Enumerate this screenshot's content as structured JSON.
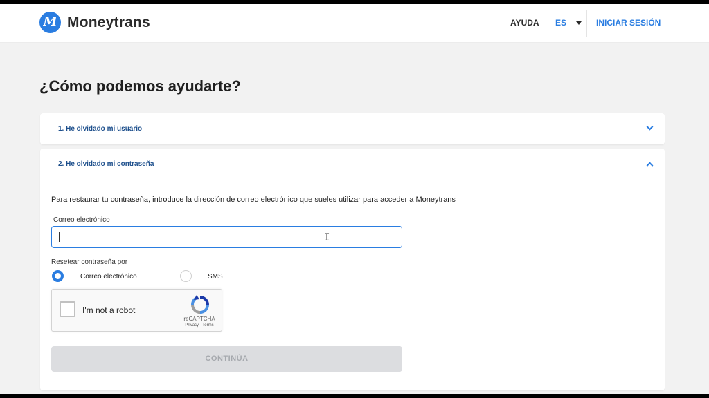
{
  "header": {
    "brand": "Moneytrans",
    "nav_help": "AYUDA",
    "language": "ES",
    "login": "INICIAR SESIÓN"
  },
  "page": {
    "title": "¿Cómo podemos ayudarte?"
  },
  "accordion": [
    {
      "title": "1. He olvidado mi usuario",
      "expanded": false
    },
    {
      "title": "2. He olvidado mi contraseña",
      "expanded": true
    }
  ],
  "form": {
    "instructions": "Para restaurar tu contraseña, introduce la dirección de correo electrónico que sueles utilizar para acceder a Moneytrans",
    "email_label": "Correo electrónico",
    "email_value": "",
    "reset_label": "Resetear contraseña por",
    "options": [
      {
        "label": "Correo electrónico",
        "selected": true
      },
      {
        "label": "SMS",
        "selected": false
      }
    ],
    "captcha": {
      "label": "I'm not a robot",
      "brand": "reCAPTCHA",
      "links": "Privacy - Terms",
      "checked": false
    },
    "submit_label": "CONTINÚA",
    "submit_enabled": false
  },
  "colors": {
    "accent": "#2a7de1",
    "accordion_title": "#1d4f8c",
    "background": "#f2f2f2",
    "button_disabled": "#dcdde0"
  },
  "icons": {
    "logo": "moneytrans-logo-icon",
    "language_dropdown": "caret-down-icon",
    "collapse": "chevron-down-icon",
    "expand": "chevron-up-icon",
    "captcha": "recaptcha-icon",
    "cursor": "text-cursor-icon"
  }
}
